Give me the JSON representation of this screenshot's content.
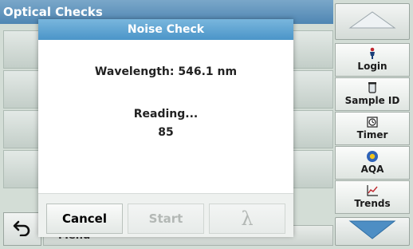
{
  "background": {
    "title": "Optical Checks",
    "bottom_label": "Menu"
  },
  "dialog": {
    "title": "Noise Check",
    "wavelength_text": "Wavelength: 546.1 nm",
    "status_text": "Reading...",
    "reading_value": "85",
    "cancel_label": "Cancel",
    "start_label": "Start",
    "lambda_label": "λ"
  },
  "side_panel": {
    "buttons": [
      {
        "label": "Login",
        "icon": "person-icon"
      },
      {
        "label": "Sample ID",
        "icon": "sample-vial-icon"
      },
      {
        "label": "Timer",
        "icon": "timer-icon"
      },
      {
        "label": "AQA",
        "icon": "aqa-icon"
      },
      {
        "label": "Trends",
        "icon": "trends-chart-icon"
      }
    ]
  },
  "colors": {
    "title_blue": "#4f86b3",
    "dialog_title_blue": "#4b95c8",
    "scroll_arrow_blue": "#4d8ec4",
    "disabled_text": "#b3b8b5"
  }
}
